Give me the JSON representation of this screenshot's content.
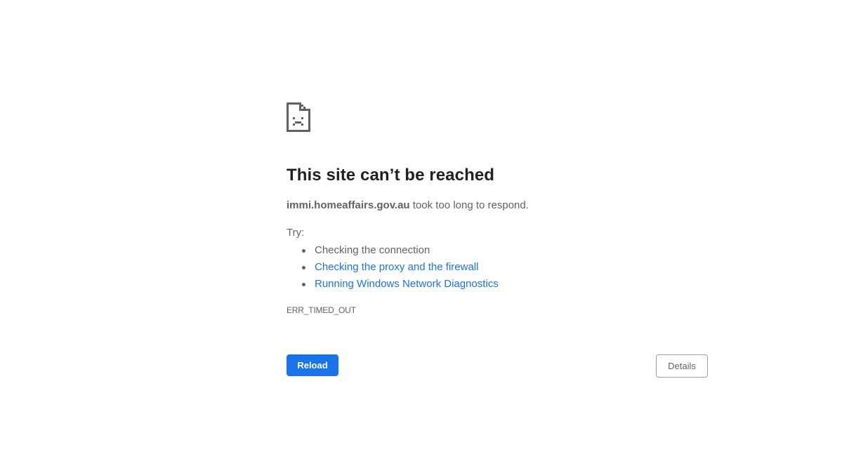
{
  "error_page": {
    "icon": "sad-document-icon",
    "title": "This site can’t be reached",
    "host": "immi.homeaffairs.gov.au",
    "message_suffix": " took too long to respond.",
    "try_label": "Try:",
    "suggestions": [
      {
        "text": "Checking the connection",
        "is_link": false
      },
      {
        "text": "Checking the proxy and the firewall",
        "is_link": true
      },
      {
        "text": "Running Windows Network Diagnostics",
        "is_link": true
      }
    ],
    "error_code": "ERR_TIMED_OUT"
  },
  "buttons": {
    "reload_label": "Reload",
    "details_label": "Details"
  },
  "colors": {
    "link": "#1a73e8",
    "primary_button": "#1a73e8",
    "title": "#202124",
    "body_text": "#5f6368"
  }
}
